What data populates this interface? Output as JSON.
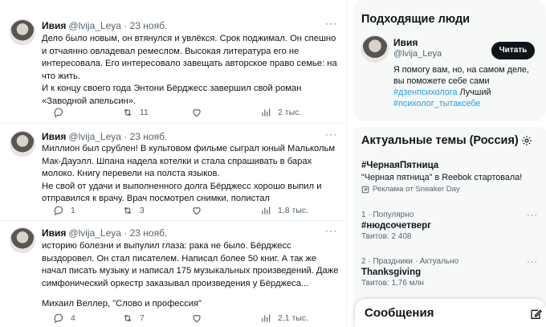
{
  "tweets": [
    {
      "name": "Ивия",
      "meta": "@lvija_Leya · 23 нояб.",
      "text": [
        "Дело было новым, он втянулся и увлёкся. Срок поджимал. Он спешно и отчаянно овладевал ремеслом. Высокая литература его не интересовала. Его интересовало завещать авторское право семье: на что жить.",
        "И к концу своего года Энтони Бёрджесс завершил свой роман «Заводной апельсин»."
      ],
      "actions": {
        "reply": "",
        "retweet": "11",
        "like": "",
        "views": "2 тыс."
      }
    },
    {
      "name": "Ивия",
      "meta": "@lvija_Leya · 23 нояб.",
      "text": [
        "Миллион был срублен! В культовом фильме сыграл юный Малькольм Мак-Дауэлл. Шпана надела котелки и стала спрашивать в барах молоко. Книгу перевели на полста языков.",
        "Не свой от удачи и выполненного долга Бёрджесс хорошо выпил и отправился к врачу. Врач посмотрел снимки, полистал"
      ],
      "actions": {
        "reply": "1",
        "retweet": "3",
        "like": "",
        "views": "1,8 тыс."
      }
    },
    {
      "name": "Ивия",
      "meta": "@lvija_Leya · 23 нояб.",
      "text": [
        "историю болезни и выпулил глаза: рака не было. Бёрджесс выздоровел. Он стал писателем. Написал более 50 книг. А так же начал писать музыку и написал 175 музыкальных произведений. Даже симфонический оркестр заказывал произведения у Бёрджеса...",
        "",
        "Михаил Веллер, \"Слово и профессия\""
      ],
      "actions": {
        "reply": "4",
        "retweet": "7",
        "like": "",
        "views": "2,1 тыс."
      }
    }
  ],
  "who_to_follow": {
    "title": "Подходящие люди",
    "name": "Ивия",
    "handle": "@lvija_Leya",
    "follow_label": "Читать",
    "bio": "Я помогу вам, но, на самом деле, вы поможете себе сами",
    "tags": [
      "#дзенпсихолога",
      "#психолог_тытаксебе"
    ],
    "bio_tail": " Лучший"
  },
  "trends": {
    "title": "Актуальные темы (Россия)",
    "items": [
      {
        "name": "#ЧернаяПятница",
        "desc": "\"Черная пятница\" в Reebok стартовала!",
        "promo": "Реклама от Sneaker Day"
      },
      {
        "meta": "1 · Популярно",
        "name": "#нюдсочетверг",
        "count": "Твитов: 2 408"
      },
      {
        "meta": "2 · Праздники · Актуально",
        "name": "Thanksgiving",
        "count": "Твитов: 1,76 млн"
      }
    ]
  },
  "messages": {
    "title": "Сообщения"
  },
  "colors": {
    "accent": "#1d9bf0",
    "text": "#0f1419",
    "muted": "#536471",
    "panel": "#f7f9f9"
  },
  "icons": [
    "reply-icon",
    "retweet-icon",
    "like-icon",
    "views-icon",
    "more-icon",
    "gear-icon",
    "promo-icon",
    "new-message-icon"
  ]
}
